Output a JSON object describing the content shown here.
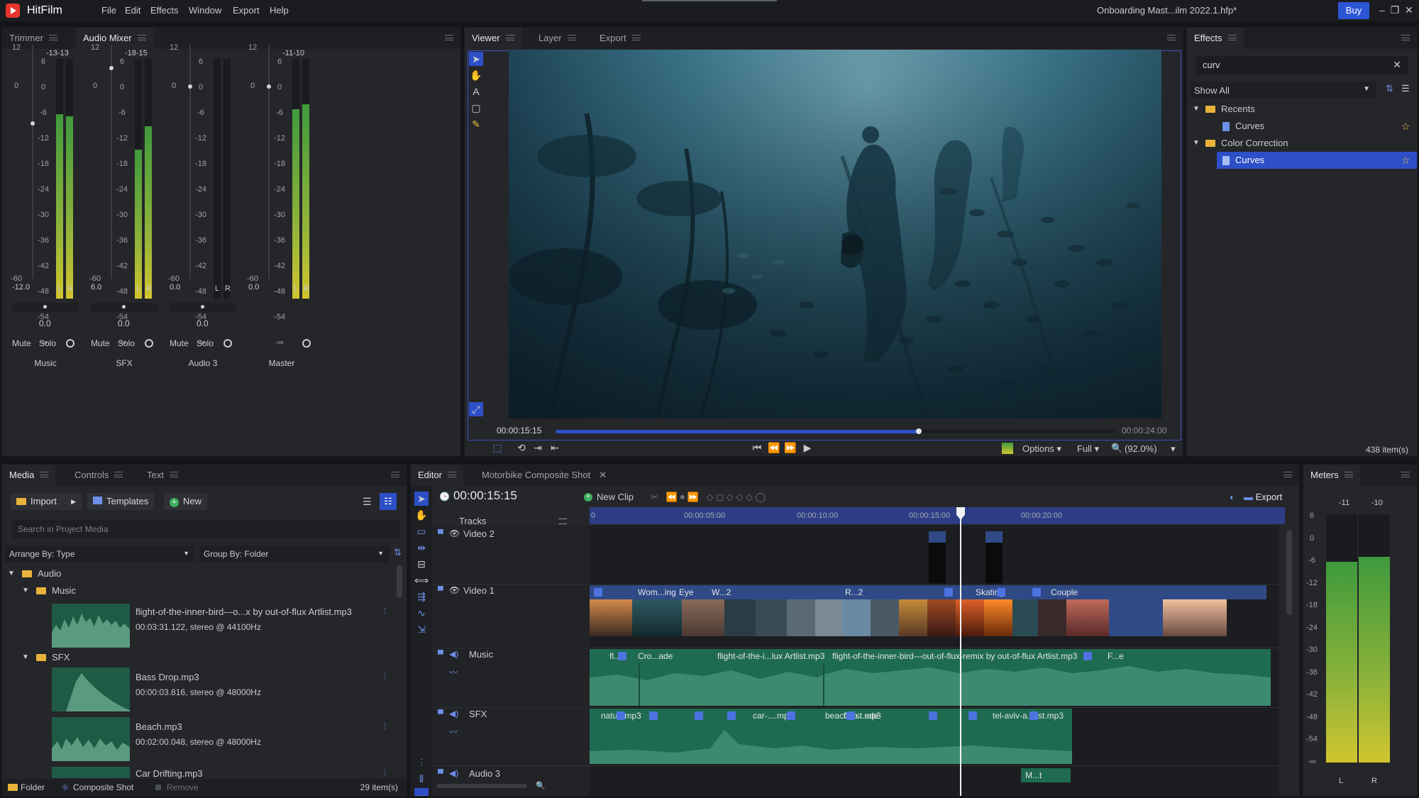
{
  "app": {
    "name": "HitFilm",
    "project_title": "Onboarding Mast...ilm 2022.1.hfp*",
    "menu": [
      "File",
      "Edit",
      "Effects",
      "Window",
      "Export",
      "Help"
    ],
    "buy_label": "Buy"
  },
  "trimmer_panel": {
    "tabs": [
      "Trimmer",
      "Audio Mixer"
    ],
    "channels": [
      {
        "name": "Music",
        "peak": "-13-13",
        "gain_readout": "-12.0",
        "pan": "0.0",
        "level_l": 0.77,
        "level_r": 0.76
      },
      {
        "name": "SFX",
        "peak": "-18-15",
        "gain_readout": "6.0",
        "pan": "0.0",
        "level_l": 0.62,
        "level_r": 0.72
      },
      {
        "name": "Audio 3",
        "peak": "",
        "gain_readout": "0.0",
        "pan": "0.0",
        "level_l": 0,
        "level_r": 0
      },
      {
        "name": "Master",
        "peak": "-11-10",
        "gain_readout": "0.0",
        "pan": "",
        "level_l": 0.79,
        "level_r": 0.81
      }
    ],
    "scale_top": "12",
    "scale_zero": "0",
    "scale_bottom": "-60",
    "meter_scale": [
      "6",
      "0",
      "-6",
      "-12",
      "-18",
      "-24",
      "-30",
      "-36",
      "-42",
      "-48",
      "-54",
      "-∞"
    ],
    "lr_labels": [
      "L",
      "R"
    ],
    "mute_label": "Mute",
    "solo_label": "Solo"
  },
  "viewer_panel": {
    "tabs": [
      "Viewer",
      "Layer",
      "Export"
    ],
    "current_time": "00:00:15:15",
    "end_time": "00:00:24:00",
    "playhead_fraction": 0.65,
    "options_label": "Options",
    "quality_label": "Full",
    "zoom_label": "(92.0%)"
  },
  "effects_panel": {
    "tab": "Effects",
    "search_value": "curv",
    "filter_label": "Show All",
    "tree": [
      {
        "type": "folder",
        "label": "Recents"
      },
      {
        "type": "file",
        "label": "Curves",
        "selected": false
      },
      {
        "type": "folder",
        "label": "Color Correction"
      },
      {
        "type": "file",
        "label": "Curves",
        "selected": true
      }
    ],
    "item_count": "438 item(s)"
  },
  "media_panel": {
    "tabs": [
      "Media",
      "Controls",
      "Text"
    ],
    "import_label": "Import",
    "templates_label": "Templates",
    "new_label": "New",
    "search_placeholder": "Search in Project Media",
    "arrange_label": "Arrange By: Type",
    "group_label": "Group By: Folder",
    "folders": {
      "audio": "Audio",
      "music": "Music",
      "sfx": "SFX"
    },
    "items": [
      {
        "name": "flight-of-the-inner-bird---o...x by out-of-flux Artlist.mp3",
        "info": "00:03:31.122, stereo @ 44100Hz"
      },
      {
        "name": "Bass Drop.mp3",
        "info": "00:00:03.816, stereo @ 48000Hz"
      },
      {
        "name": "Beach.mp3",
        "info": "00:02:00.048, stereo @ 48000Hz"
      },
      {
        "name": "Car Drifting.mp3",
        "info": ""
      }
    ],
    "footer_folder": "Folder",
    "footer_composite": "Composite Shot",
    "footer_remove": "Remove",
    "footer_count": "29 item(s)"
  },
  "editor_panel": {
    "tabs": [
      "Editor",
      "Motorbike Composite Shot"
    ],
    "timecode": "00:00:15:15",
    "new_clip_label": "New Clip",
    "export_label": "Export",
    "tracks_label": "Tracks",
    "ruler": [
      "0",
      "00:00:05:00",
      "00:00:10:00",
      "00:00:15:00",
      "00:00:20:00"
    ],
    "tracks": [
      {
        "name": "Video 2"
      },
      {
        "name": "Video 1"
      },
      {
        "name": "Music"
      },
      {
        "name": "SFX"
      },
      {
        "name": "Audio 3"
      }
    ],
    "video1_clips": [
      "Wom...ing",
      "Eye",
      "W...2",
      "R...2",
      "Skating",
      "Couple"
    ],
    "music_clips": [
      "fl...3",
      "Cro...ade",
      "flight-of-the-i...lux Artlist.mp3",
      "flight-of-the-inner-bird---out-of-flux-remix by out-of-flux Artlist.mp3",
      "F...e"
    ],
    "sfx_clips": [
      "natu...mp3",
      "car-....mp3",
      "beach...st.mp3",
      "Cro...ade",
      "tel-aviv-a...list.mp3"
    ],
    "audio3_clips": [
      "M...t"
    ]
  },
  "meters_panel": {
    "tab": "Meters",
    "peaks": [
      "-11",
      "-10"
    ],
    "scale": [
      "6",
      "0",
      "-6",
      "-12",
      "-18",
      "-24",
      "-30",
      "-36",
      "-42",
      "-48",
      "-54",
      "-∞"
    ],
    "lr_labels": [
      "L",
      "R"
    ],
    "level_l": 0.81,
    "level_r": 0.83
  },
  "colors": {
    "accent": "#2c56d6",
    "selection": "#2d4fc7",
    "meter_green": "#3f9a3c",
    "meter_yellow": "#d1c530",
    "audio_clip": "#1f6b52",
    "video_clip": "#2f4a86"
  }
}
